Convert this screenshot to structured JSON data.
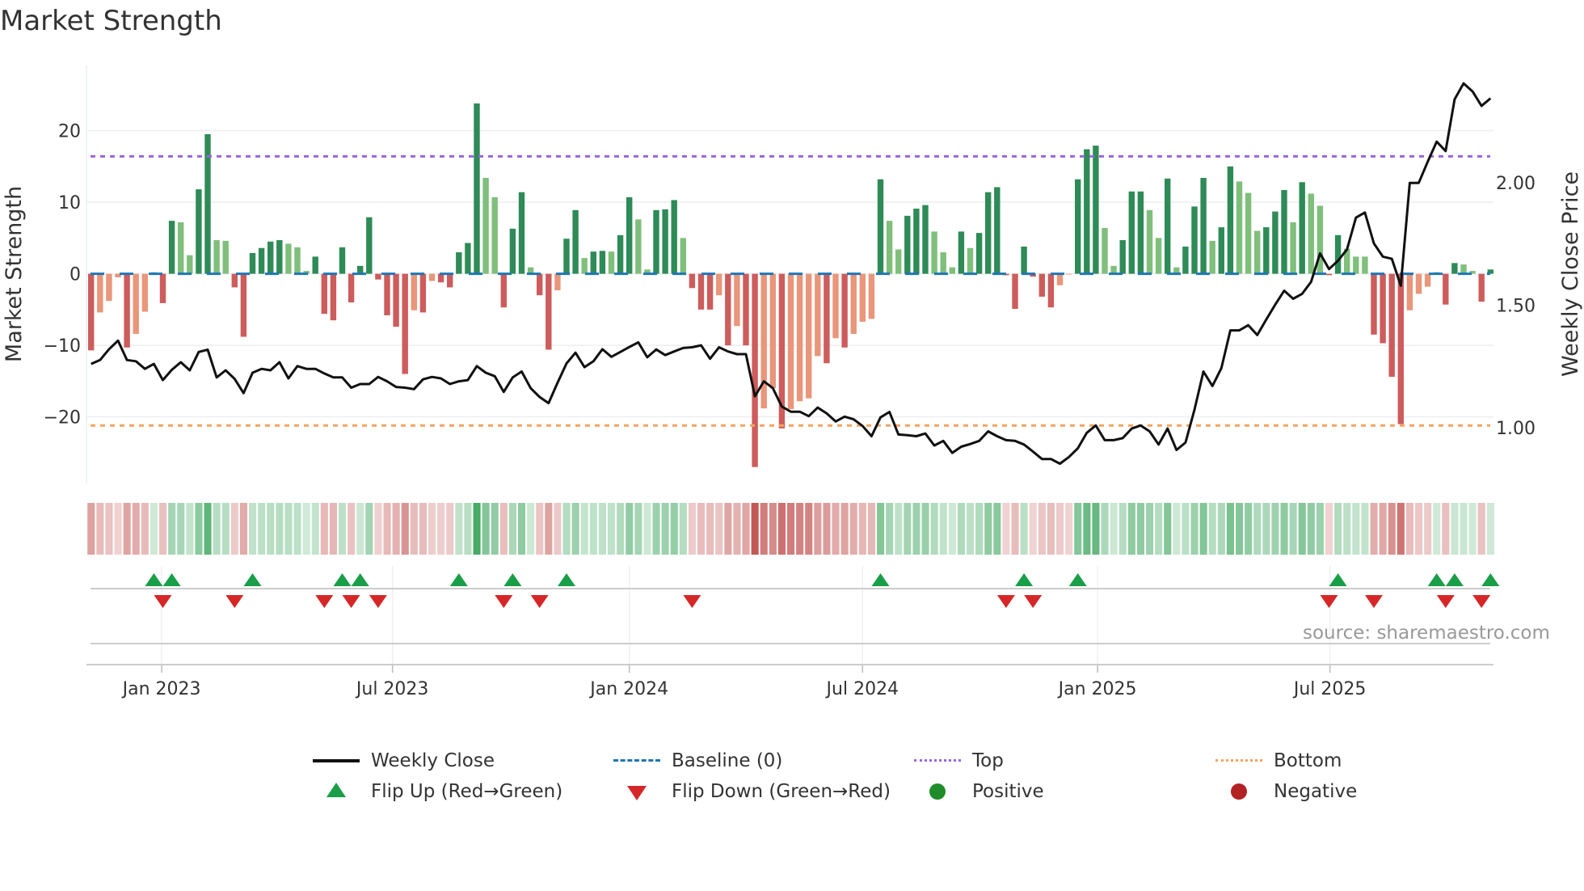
{
  "chart_data": {
    "type": "bar",
    "title": "Market Strength",
    "ylabel": "Market Strength",
    "y2label": "Weekly Close Price",
    "ylim": [
      -29.3,
      29.1
    ],
    "y2lim": [
      0.773,
      2.479
    ],
    "yticks": [
      {
        "v": 20,
        "label": "20"
      },
      {
        "v": 10,
        "label": "10"
      },
      {
        "v": 0,
        "label": "0"
      },
      {
        "v": -10,
        "label": "−10"
      },
      {
        "v": -20,
        "label": "−20"
      }
    ],
    "y2ticks": [
      {
        "v": 2.0,
        "label": "2.00"
      },
      {
        "v": 1.5,
        "label": "1.50"
      },
      {
        "v": 1.0,
        "label": "1.00"
      }
    ],
    "xticks": [
      {
        "week": 7.87,
        "label": "Jan 2023"
      },
      {
        "week": 33.6,
        "label": "Jul 2023"
      },
      {
        "week": 60.0,
        "label": "Jan 2024"
      },
      {
        "week": 86.0,
        "label": "Jul 2024"
      },
      {
        "week": 112.2,
        "label": "Jan 2025"
      },
      {
        "week": 138.1,
        "label": "Jul 2025"
      }
    ],
    "top_level": 16.4,
    "bottom_level": -21.2,
    "strength": [
      -10.7,
      -5.4,
      -3.8,
      -0.5,
      -10.3,
      -8.4,
      -5.3,
      0.2,
      -4.1,
      7.4,
      7.2,
      2.6,
      11.8,
      19.5,
      4.7,
      4.6,
      -1.9,
      -8.8,
      2.9,
      3.6,
      4.5,
      4.7,
      4.2,
      3.7,
      0.4,
      2.4,
      -5.6,
      -6.5,
      3.7,
      -4.0,
      1.1,
      7.9,
      -0.8,
      -5.8,
      -7.4,
      -14.0,
      -5.1,
      -5.4,
      -1.0,
      -1.2,
      -1.9,
      3.0,
      4.3,
      23.8,
      13.4,
      10.7,
      -4.7,
      6.3,
      11.4,
      0.9,
      -3.0,
      -10.6,
      -2.3,
      4.9,
      8.9,
      2.2,
      3.1,
      3.2,
      3.1,
      5.4,
      10.7,
      7.6,
      0.6,
      8.9,
      9.0,
      10.3,
      5.0,
      -2.0,
      -5.0,
      -5.0,
      -3.0,
      -10.0,
      -7.3,
      -10.0,
      -27.0,
      -18.8,
      -16.0,
      -21.6,
      -18.9,
      -17.8,
      -17.4,
      -11.5,
      -12.5,
      -9.0,
      -10.3,
      -8.4,
      -6.7,
      -6.3,
      13.2,
      7.4,
      3.4,
      8.1,
      9.1,
      9.6,
      5.9,
      3.0,
      0.9,
      5.9,
      3.6,
      5.7,
      11.4,
      12.1,
      -0.2,
      -4.9,
      3.8,
      -0.4,
      -3.2,
      -4.7,
      -1.6,
      -0.1,
      13.2,
      17.4,
      17.9,
      6.4,
      1.1,
      4.7,
      11.5,
      11.5,
      8.9,
      5.0,
      13.3,
      0.9,
      3.8,
      9.4,
      13.4,
      4.6,
      6.5,
      15.0,
      12.9,
      11.3,
      6.0,
      6.5,
      8.7,
      11.7,
      7.2,
      12.8,
      11.2,
      9.5,
      -0.2,
      5.4,
      3.5,
      2.4,
      2.4,
      -8.5,
      -9.7,
      -14.4,
      -21.0,
      -5.1,
      -2.8,
      -1.8,
      0.2,
      -4.3,
      1.5,
      1.3,
      0.4,
      -3.9,
      0.6
    ],
    "bar_shade": "RSSSRSSDRDLLDDLLRRDDDDLLLDRRDRDDRRRRSRSRRDDDLLRDDLRRSDDLDDLDDLLDDDLRRRSRSRRSSRSSSSRSRSSSDLLDDDLLLDLDDDRRDRRRSSDDDLLDDDLLDLDDDLDDLLLDDDLDLLRDLLLRRRRSSSDRDLLRD",
    "close": [
      1.261,
      1.277,
      1.321,
      1.356,
      1.277,
      1.272,
      1.241,
      1.261,
      1.195,
      1.237,
      1.268,
      1.235,
      1.31,
      1.319,
      1.206,
      1.235,
      1.2,
      1.142,
      1.225,
      1.241,
      1.235,
      1.268,
      1.202,
      1.252,
      1.241,
      1.241,
      1.222,
      1.206,
      1.206,
      1.164,
      1.179,
      1.179,
      1.208,
      1.19,
      1.167,
      1.164,
      1.158,
      1.198,
      1.208,
      1.202,
      1.179,
      1.19,
      1.195,
      1.252,
      1.225,
      1.211,
      1.147,
      1.206,
      1.23,
      1.162,
      1.126,
      1.101,
      1.184,
      1.263,
      1.307,
      1.248,
      1.272,
      1.321,
      1.29,
      1.31,
      1.33,
      1.349,
      1.288,
      1.32,
      1.297,
      1.312,
      1.326,
      1.329,
      1.337,
      1.282,
      1.329,
      1.312,
      1.301,
      1.301,
      1.129,
      1.19,
      1.162,
      1.087,
      1.066,
      1.066,
      1.048,
      1.083,
      1.059,
      1.026,
      1.046,
      1.035,
      1.008,
      0.966,
      1.043,
      1.065,
      0.973,
      0.97,
      0.966,
      0.977,
      0.928,
      0.947,
      0.898,
      0.923,
      0.934,
      0.947,
      0.986,
      0.966,
      0.95,
      0.947,
      0.932,
      0.903,
      0.873,
      0.873,
      0.854,
      0.881,
      0.917,
      0.98,
      1.01,
      0.95,
      0.95,
      0.958,
      0.997,
      1.01,
      0.986,
      0.932,
      0.997,
      0.91,
      0.94,
      1.074,
      1.23,
      1.171,
      1.244,
      1.398,
      1.398,
      1.419,
      1.379,
      1.442,
      1.503,
      1.56,
      1.527,
      1.547,
      1.596,
      1.712,
      1.648,
      1.682,
      1.728,
      1.858,
      1.879,
      1.753,
      1.699,
      1.69,
      1.58,
      2.0,
      2.0,
      2.086,
      2.168,
      2.13,
      2.341,
      2.406,
      2.373,
      2.314,
      2.345
    ],
    "legend": {
      "weekly_close": "Weekly Close",
      "baseline": "Baseline (0)",
      "top": "Top",
      "bottom": "Bottom",
      "flip_up": "Flip Up (Red→Green)",
      "flip_down": "Flip Down (Green→Red)",
      "positive": "Positive",
      "negative": "Negative"
    },
    "legend_position": "bottom",
    "colors": {
      "strong_pos": "#2e8b57",
      "weak_pos": "#7fbf7b",
      "strong_neg": "#cd5c5c",
      "weak_neg": "#e9967a",
      "close": "#111111",
      "baseline": "#1f77b4",
      "top": "#9966dd",
      "bottom": "#f4a460",
      "flip_up": "#1a9e48",
      "flip_down": "#d62728",
      "positive": "#1e8c2a",
      "negative": "#b22222"
    }
  },
  "source": "source: sharemaestro.com"
}
